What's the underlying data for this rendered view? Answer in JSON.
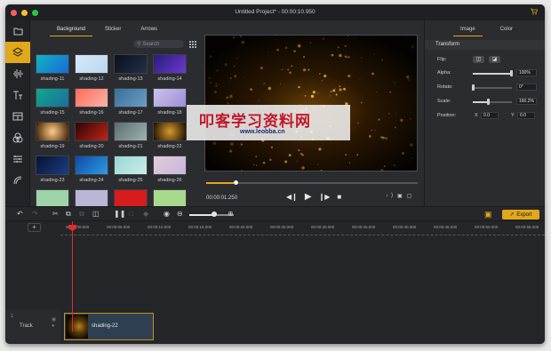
{
  "window": {
    "title": "Untitled Project* - 00:00:10.950",
    "traffic": [
      "#fc5f57",
      "#fdbc2e",
      "#27c840"
    ]
  },
  "leftbar": {
    "items": [
      {
        "icon": "folder-icon"
      },
      {
        "icon": "layers-icon",
        "active": true
      },
      {
        "icon": "audio-wave-icon"
      },
      {
        "icon": "text-icon"
      },
      {
        "icon": "template-icon"
      },
      {
        "icon": "filters-icon"
      },
      {
        "icon": "transitions-icon"
      },
      {
        "icon": "elements-icon"
      }
    ]
  },
  "media": {
    "tabs": [
      "Background",
      "Sticker",
      "Arrows"
    ],
    "active_tab": "Background",
    "search_placeholder": "Search",
    "thumbnails": [
      {
        "label": "shading-11",
        "color": "linear-gradient(135deg,#0fb3c2,#1a6bd8)"
      },
      {
        "label": "shading-12",
        "color": "linear-gradient(135deg,#d7e8f6,#b9d7ef)"
      },
      {
        "label": "shading-13",
        "color": "linear-gradient(135deg,#0b0f1c,#223047)"
      },
      {
        "label": "shading-14",
        "color": "linear-gradient(135deg,#2a1a7a,#6b3bd0)"
      },
      {
        "label": "shading-15",
        "color": "linear-gradient(135deg,#0fa88a,#1c6d9e)"
      },
      {
        "label": "shading-16",
        "color": "linear-gradient(135deg,#ff6a5a,#f7b5a8)"
      },
      {
        "label": "shading-17",
        "color": "linear-gradient(135deg,#3a6e9a,#6aa0c4)"
      },
      {
        "label": "shading-18",
        "color": "linear-gradient(135deg,#c9c3ea,#9e8ed8)"
      },
      {
        "label": "shading-19",
        "color": "radial-gradient(circle,#ffcc88,#3b1c00)"
      },
      {
        "label": "shading-20",
        "color": "linear-gradient(135deg,#2b0505,#c2241a)"
      },
      {
        "label": "shading-21",
        "color": "linear-gradient(135deg,#5d6c6c,#9db3b3)"
      },
      {
        "label": "shading-22",
        "color": "radial-gradient(circle,#d49a2a,#1a0d02)"
      },
      {
        "label": "shading-23",
        "color": "linear-gradient(135deg,#06122e,#1c3f88)"
      },
      {
        "label": "shading-24",
        "color": "linear-gradient(135deg,#0e4aa8,#2f9be0)"
      },
      {
        "label": "shading-25",
        "color": "linear-gradient(135deg,#9ad8d3,#c8ece8)"
      },
      {
        "label": "shading-26",
        "color": "linear-gradient(135deg,#e2ccd8,#c7b6dc)"
      },
      {
        "label": "",
        "color": "#9fd3a8"
      },
      {
        "label": "",
        "color": "#b9b6d6"
      },
      {
        "label": "",
        "color": "#d61c1c"
      },
      {
        "label": "",
        "color": "#a8d98c"
      }
    ]
  },
  "preview": {
    "time": "00:00:01.250",
    "progress": 0.13,
    "controls": [
      "prev-frame-icon",
      "play-icon",
      "next-frame-icon",
      "stop-icon"
    ],
    "right_controls": [
      "volume-icon",
      "snapshot-icon",
      "fullscreen-icon"
    ]
  },
  "props": {
    "tabs": [
      "Image",
      "Color"
    ],
    "active_tab": "Image",
    "section": "Transform",
    "flip_label": "Flip:",
    "alpha_label": "Alpha:",
    "alpha_value": "100%",
    "rotate_label": "Rotate:",
    "rotate_value": "0°",
    "scale_label": "Scale:",
    "scale_value": "160.2%",
    "position_label": "Position:",
    "x_label": "X",
    "x_value": "0.0",
    "y_label": "Y",
    "y_value": "0.0"
  },
  "toolbar": {
    "export_label": "Export"
  },
  "timeline": {
    "ticks": [
      "00:00:00.000",
      "00:00:05.000",
      "00:00:10.000",
      "00:00:15.000",
      "00:00:20.000",
      "00:00:25.000",
      "00:00:30.000",
      "00:00:35.000",
      "00:00:40.000",
      "00:00:45.000",
      "00:00:50.000",
      "00:00:55.000"
    ],
    "track_number": "1",
    "track_label": "Track",
    "clip_label": "shading-22"
  },
  "watermark": {
    "main": "叩客学习资料网",
    "url": "www.leobba.cn"
  }
}
